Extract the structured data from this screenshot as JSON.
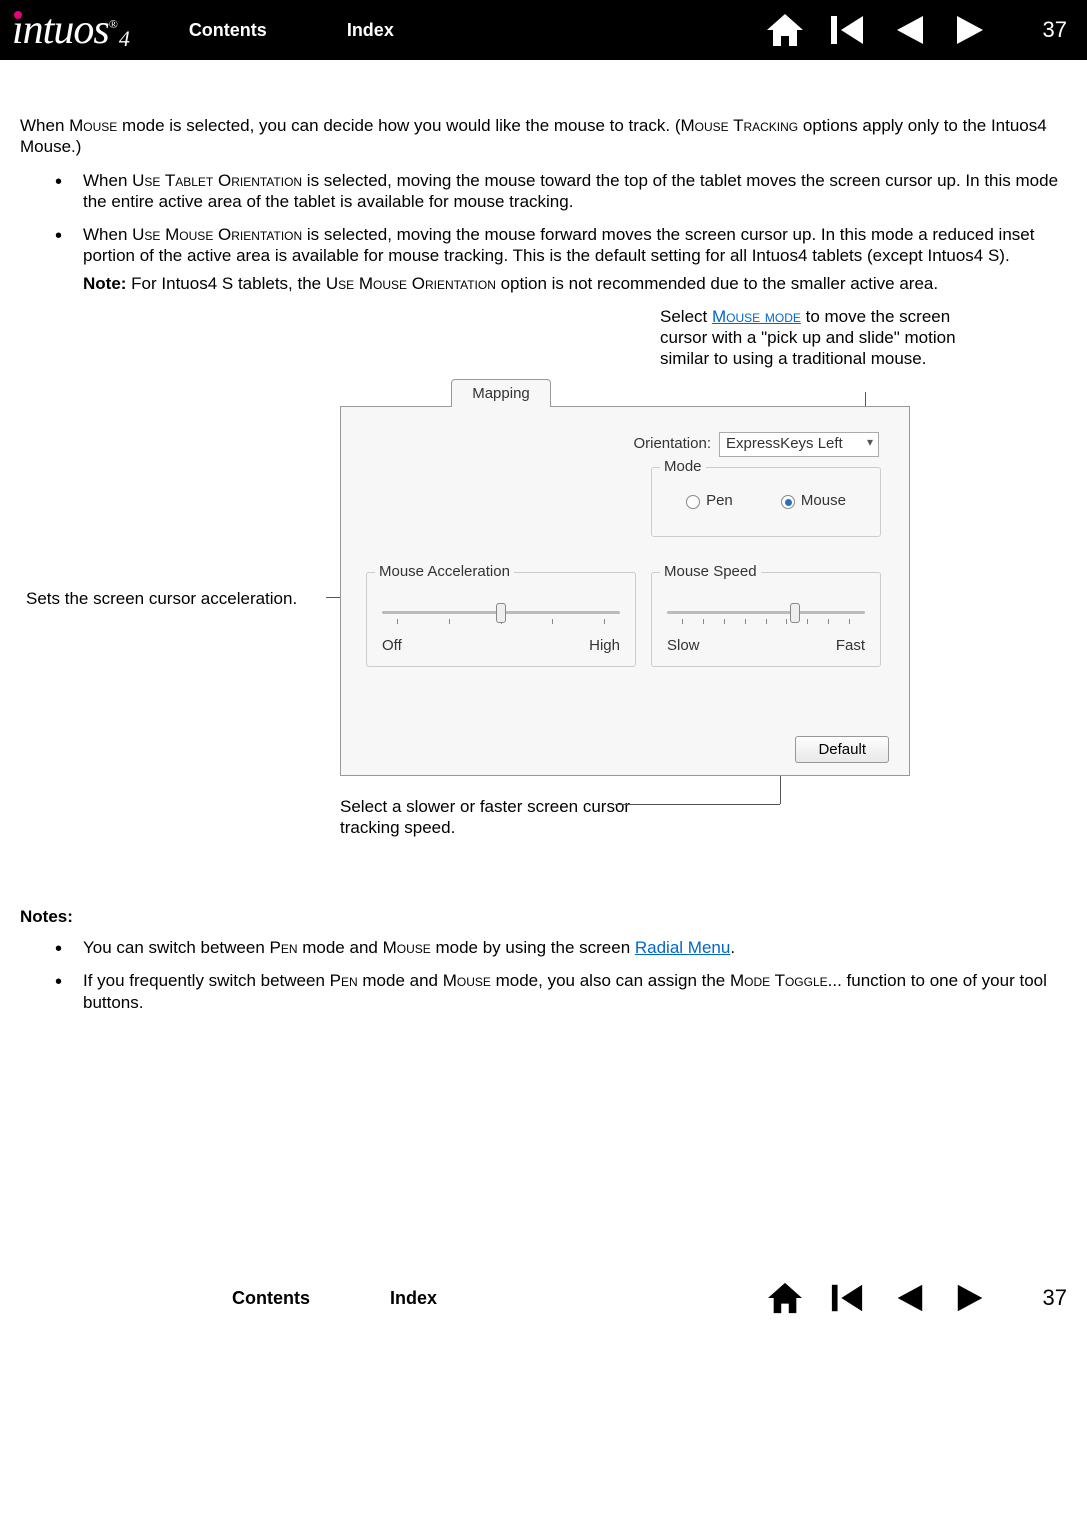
{
  "header": {
    "logo_text": "intuos",
    "logo_suffix": "4",
    "contents": "Contents",
    "index": "Index",
    "page_num": "37"
  },
  "body": {
    "intro_a": "When ",
    "intro_b": "Mouse",
    "intro_c": " mode is selected, you can decide how you would like the mouse to track.  (",
    "intro_d": "Mouse Tracking",
    "intro_e": " options apply only to the Intuos4 Mouse.)",
    "b1_a": "When ",
    "b1_b": "Use Tablet Orientation",
    "b1_c": " is selected, moving the mouse toward the top of the tablet moves the screen cursor up.  In this mode the entire active area of the tablet is available for mouse tracking.",
    "b2_a": "When ",
    "b2_b": "Use Mouse Orientation",
    "b2_c": " is selected, moving the mouse forward moves the screen cursor up.  In this mode a reduced inset portion of the active area is available for mouse tracking.  This is the default setting for all Intuos4 tablets (except Intuos4 S).",
    "b2_note_a": "Note:",
    "b2_note_b": " For Intuos4 S tablets, the ",
    "b2_note_c": "Use Mouse Orientation",
    "b2_note_d": " option is not recommended due to the smaller active area."
  },
  "callouts": {
    "mouse_a": "Select ",
    "mouse_link": "Mouse mode",
    "mouse_b": " to move the screen cursor with a \"pick up and slide\" motion similar to using a traditional mouse.",
    "accel": "Sets the screen cursor acceleration.",
    "speed": "Select a slower or faster screen cursor tracking speed."
  },
  "dialog": {
    "tab": "Mapping",
    "orientation_label": "Orientation:",
    "orientation_value": "ExpressKeys Left",
    "mode_label": "Mode",
    "pen": "Pen",
    "mouse": "Mouse",
    "accel_label": "Mouse Acceleration",
    "accel_low": "Off",
    "accel_high": "High",
    "speed_label": "Mouse Speed",
    "speed_low": "Slow",
    "speed_high": "Fast",
    "default_btn": "Default"
  },
  "notes": {
    "heading": "Notes:",
    "n1_a": "You can switch between ",
    "n1_b": "Pen",
    "n1_c": " mode and ",
    "n1_d": "Mouse",
    "n1_e": " mode by using the screen ",
    "n1_link": "Radial Menu",
    "n1_f": ".",
    "n2_a": "If you frequently switch between ",
    "n2_b": "Pen",
    "n2_c": " mode and ",
    "n2_d": "Mouse",
    "n2_e": " mode, you also can assign the ",
    "n2_f": "Mode Toggle",
    "n2_g": "... function to one of your tool buttons."
  },
  "footer": {
    "contents": "Contents",
    "index": "Index",
    "page_num": "37"
  }
}
